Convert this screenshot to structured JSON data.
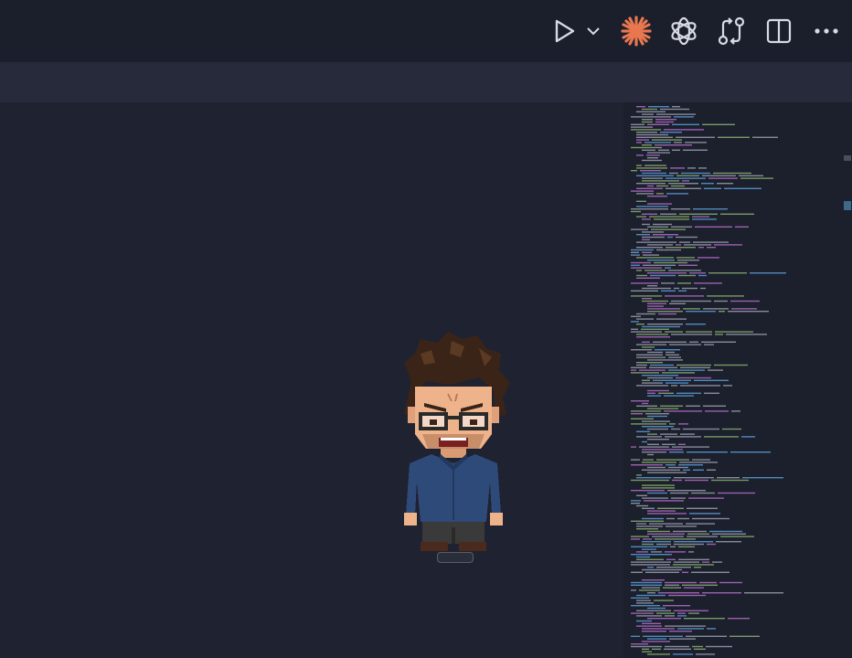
{
  "titlebar": {
    "actions": [
      {
        "icon": "run-play-icon"
      },
      {
        "icon": "run-dropdown-chevron-icon"
      },
      {
        "icon": "claude-sparkle-icon"
      },
      {
        "icon": "openai-icon"
      },
      {
        "icon": "compare-changes-icon"
      },
      {
        "icon": "split-editor-icon"
      },
      {
        "icon": "more-actions-icon"
      }
    ]
  },
  "colors": {
    "titlebar_bg": "#1b1e2b",
    "tabbar_bg": "#262a3a",
    "editor_bg": "#1f2230",
    "minimap_bg": "#1c1f2c",
    "claude_accent": "#e8774f",
    "icon_fg": "#d7dae3",
    "minimap_keyword": "#c678dd",
    "minimap_function": "#61afef",
    "minimap_string": "#98c379",
    "minimap_text": "#abb2bf"
  },
  "pet": {
    "icon": "pixel-art-angry-man-pet"
  }
}
